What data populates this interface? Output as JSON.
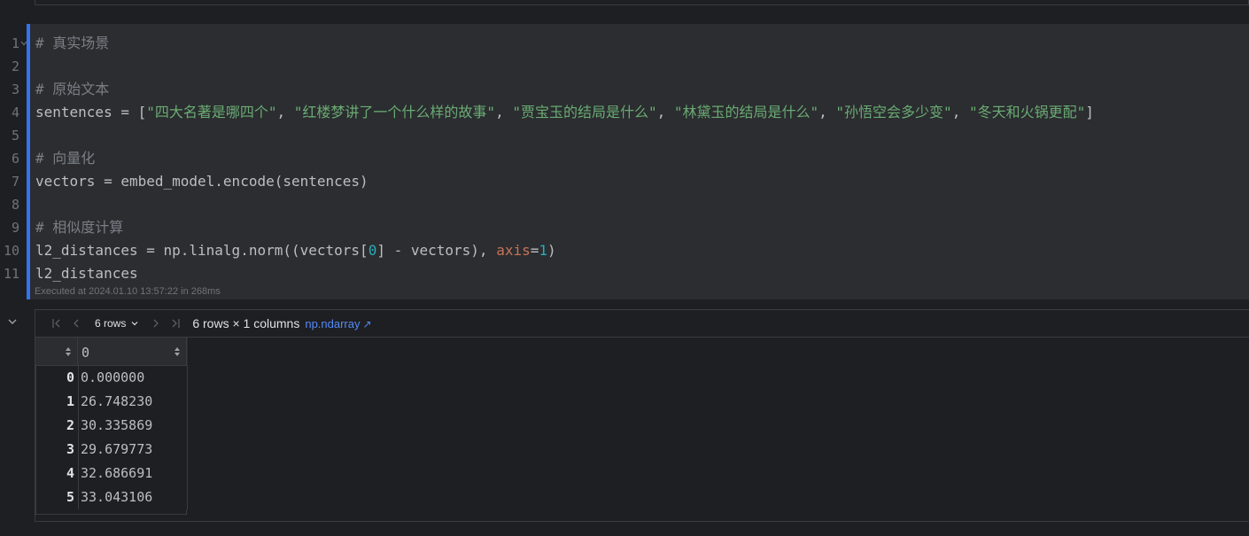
{
  "cell": {
    "line_numbers": [
      "1",
      "2",
      "3",
      "4",
      "5",
      "6",
      "7",
      "8",
      "9",
      "10",
      "11"
    ],
    "lines": [
      [
        {
          "t": "com",
          "v": "# 真实场景"
        }
      ],
      [],
      [
        {
          "t": "com",
          "v": "# 原始文本"
        }
      ],
      [
        {
          "t": "txt",
          "v": "sentences = ["
        },
        {
          "t": "str",
          "v": "\"四大名著是哪四个\""
        },
        {
          "t": "txt",
          "v": ", "
        },
        {
          "t": "str",
          "v": "\"红楼梦讲了一个什么样的故事\""
        },
        {
          "t": "txt",
          "v": ", "
        },
        {
          "t": "str",
          "v": "\"贾宝玉的结局是什么\""
        },
        {
          "t": "txt",
          "v": ", "
        },
        {
          "t": "str",
          "v": "\"林黛玉的结局是什么\""
        },
        {
          "t": "txt",
          "v": ", "
        },
        {
          "t": "str",
          "v": "\"孙悟空会多少变\""
        },
        {
          "t": "txt",
          "v": ", "
        },
        {
          "t": "str",
          "v": "\"冬天和火锅更配\""
        },
        {
          "t": "txt",
          "v": "]"
        }
      ],
      [],
      [
        {
          "t": "com",
          "v": "# 向量化"
        }
      ],
      [
        {
          "t": "txt",
          "v": "vectors = embed_model.encode(sentences)"
        }
      ],
      [],
      [
        {
          "t": "com",
          "v": "# 相似度计算"
        }
      ],
      [
        {
          "t": "txt",
          "v": "l2_distances = np.linalg.norm((vectors["
        },
        {
          "t": "num",
          "v": "0"
        },
        {
          "t": "txt",
          "v": "] - vectors), "
        },
        {
          "t": "kw",
          "v": "axis"
        },
        {
          "t": "txt",
          "v": "="
        },
        {
          "t": "num",
          "v": "1"
        },
        {
          "t": "txt",
          "v": ")"
        }
      ],
      [
        {
          "t": "txt",
          "v": "l2_distances"
        }
      ]
    ],
    "exec_info": "Executed at 2024.01.10 13:57:22 in 268ms"
  },
  "output": {
    "rows_select": "6 rows",
    "dims": "6 rows × 1 columns",
    "type_link": "np.ndarray",
    "type_link_arrow": "↗",
    "column_header": "0",
    "rows": [
      {
        "index": "0",
        "value": "0.000000"
      },
      {
        "index": "1",
        "value": "26.748230"
      },
      {
        "index": "2",
        "value": "30.335869"
      },
      {
        "index": "3",
        "value": "29.679773"
      },
      {
        "index": "4",
        "value": "32.686691"
      },
      {
        "index": "5",
        "value": "33.043106"
      }
    ]
  },
  "icons": [
    "fold-chevron-icon",
    "output-collapse-chevron-icon",
    "first-page-icon",
    "previous-page-icon",
    "rows-dropdown-chevron-icon",
    "next-page-icon",
    "last-page-icon",
    "external-link-icon",
    "sort-icon"
  ],
  "colors": {
    "background": "#1e1f22",
    "cell_background": "#2b2d30",
    "selection_bar": "#3574f0",
    "comment": "#7a7e85",
    "string": "#6aab73",
    "number": "#2aacb8",
    "keyword": "#c77358",
    "link": "#548af7"
  }
}
